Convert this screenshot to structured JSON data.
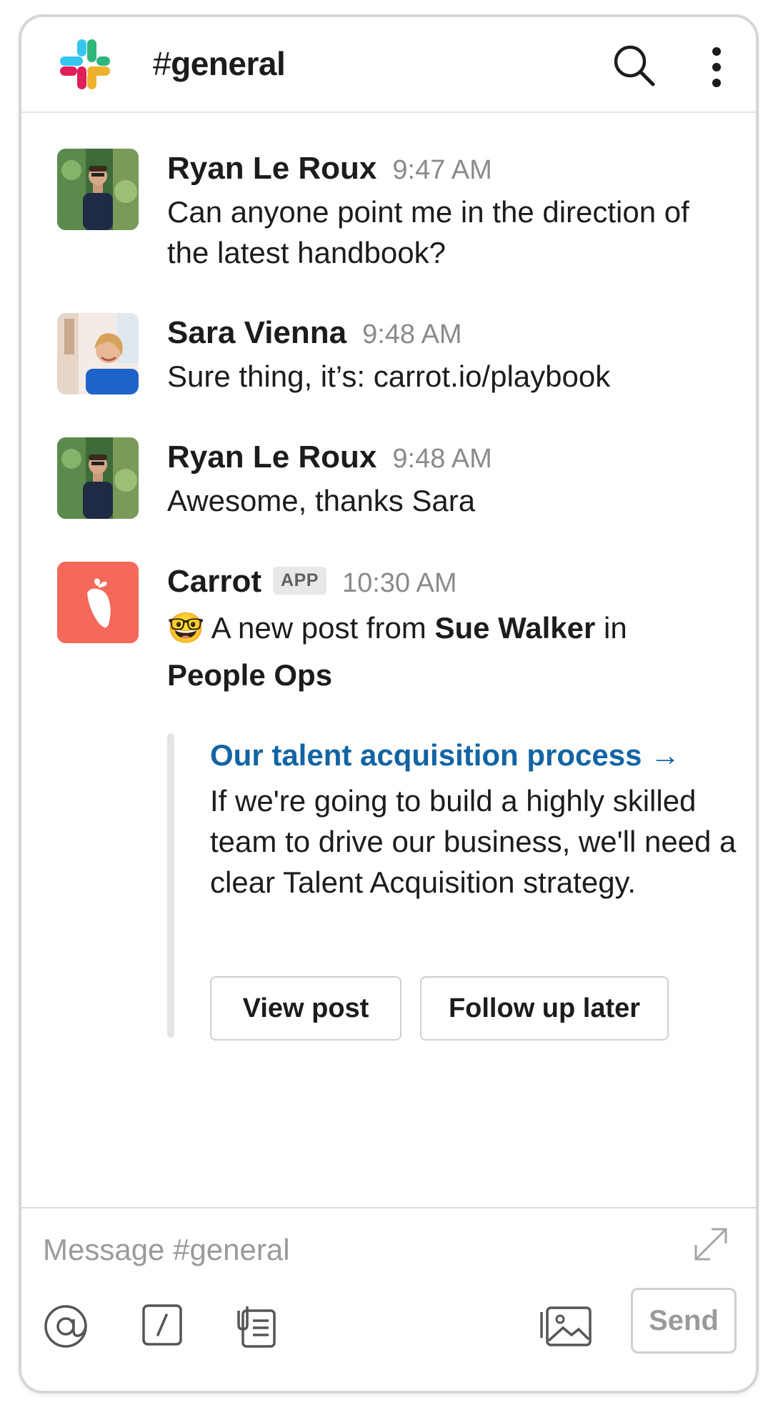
{
  "header": {
    "hash": "#",
    "channel": "general"
  },
  "messages": [
    {
      "name": "Ryan Le Roux",
      "time": "9:47 AM",
      "text": "Can anyone point me in the direction of the latest handbook?"
    },
    {
      "name": "Sara Vienna",
      "time": "9:48 AM",
      "text": "Sure thing, it’s: carrot.io/playbook"
    },
    {
      "name": "Ryan Le Roux",
      "time": "9:48 AM",
      "text": "Awesome, thanks Sara"
    }
  ],
  "carrot": {
    "name": "Carrot",
    "badge": "APP",
    "time": "10:30 AM",
    "emoji": "🤓",
    "text_prefix": " A new post from ",
    "author": "Sue Walker",
    "text_mid": " in ",
    "section": "People Ops"
  },
  "attachment": {
    "title": "Our talent acquisition process →",
    "body": "If we're going to build a highly skilled team to drive our business, we'll need a clear Talent Acquisition strategy.",
    "buttons": [
      "View post",
      "Follow up later"
    ]
  },
  "composer": {
    "placeholder": "Message #general",
    "send_label": "Send"
  },
  "colors": {
    "link_blue": "#1264a3",
    "carrot_red": "#f4695a",
    "border_gray": "#cfcfcf"
  },
  "icons": [
    "slack-logo-icon",
    "search-icon",
    "more-vertical-icon",
    "carrot-icon",
    "expand-icon",
    "mention-icon",
    "slash-command-icon",
    "attach-file-icon",
    "image-icon"
  ]
}
